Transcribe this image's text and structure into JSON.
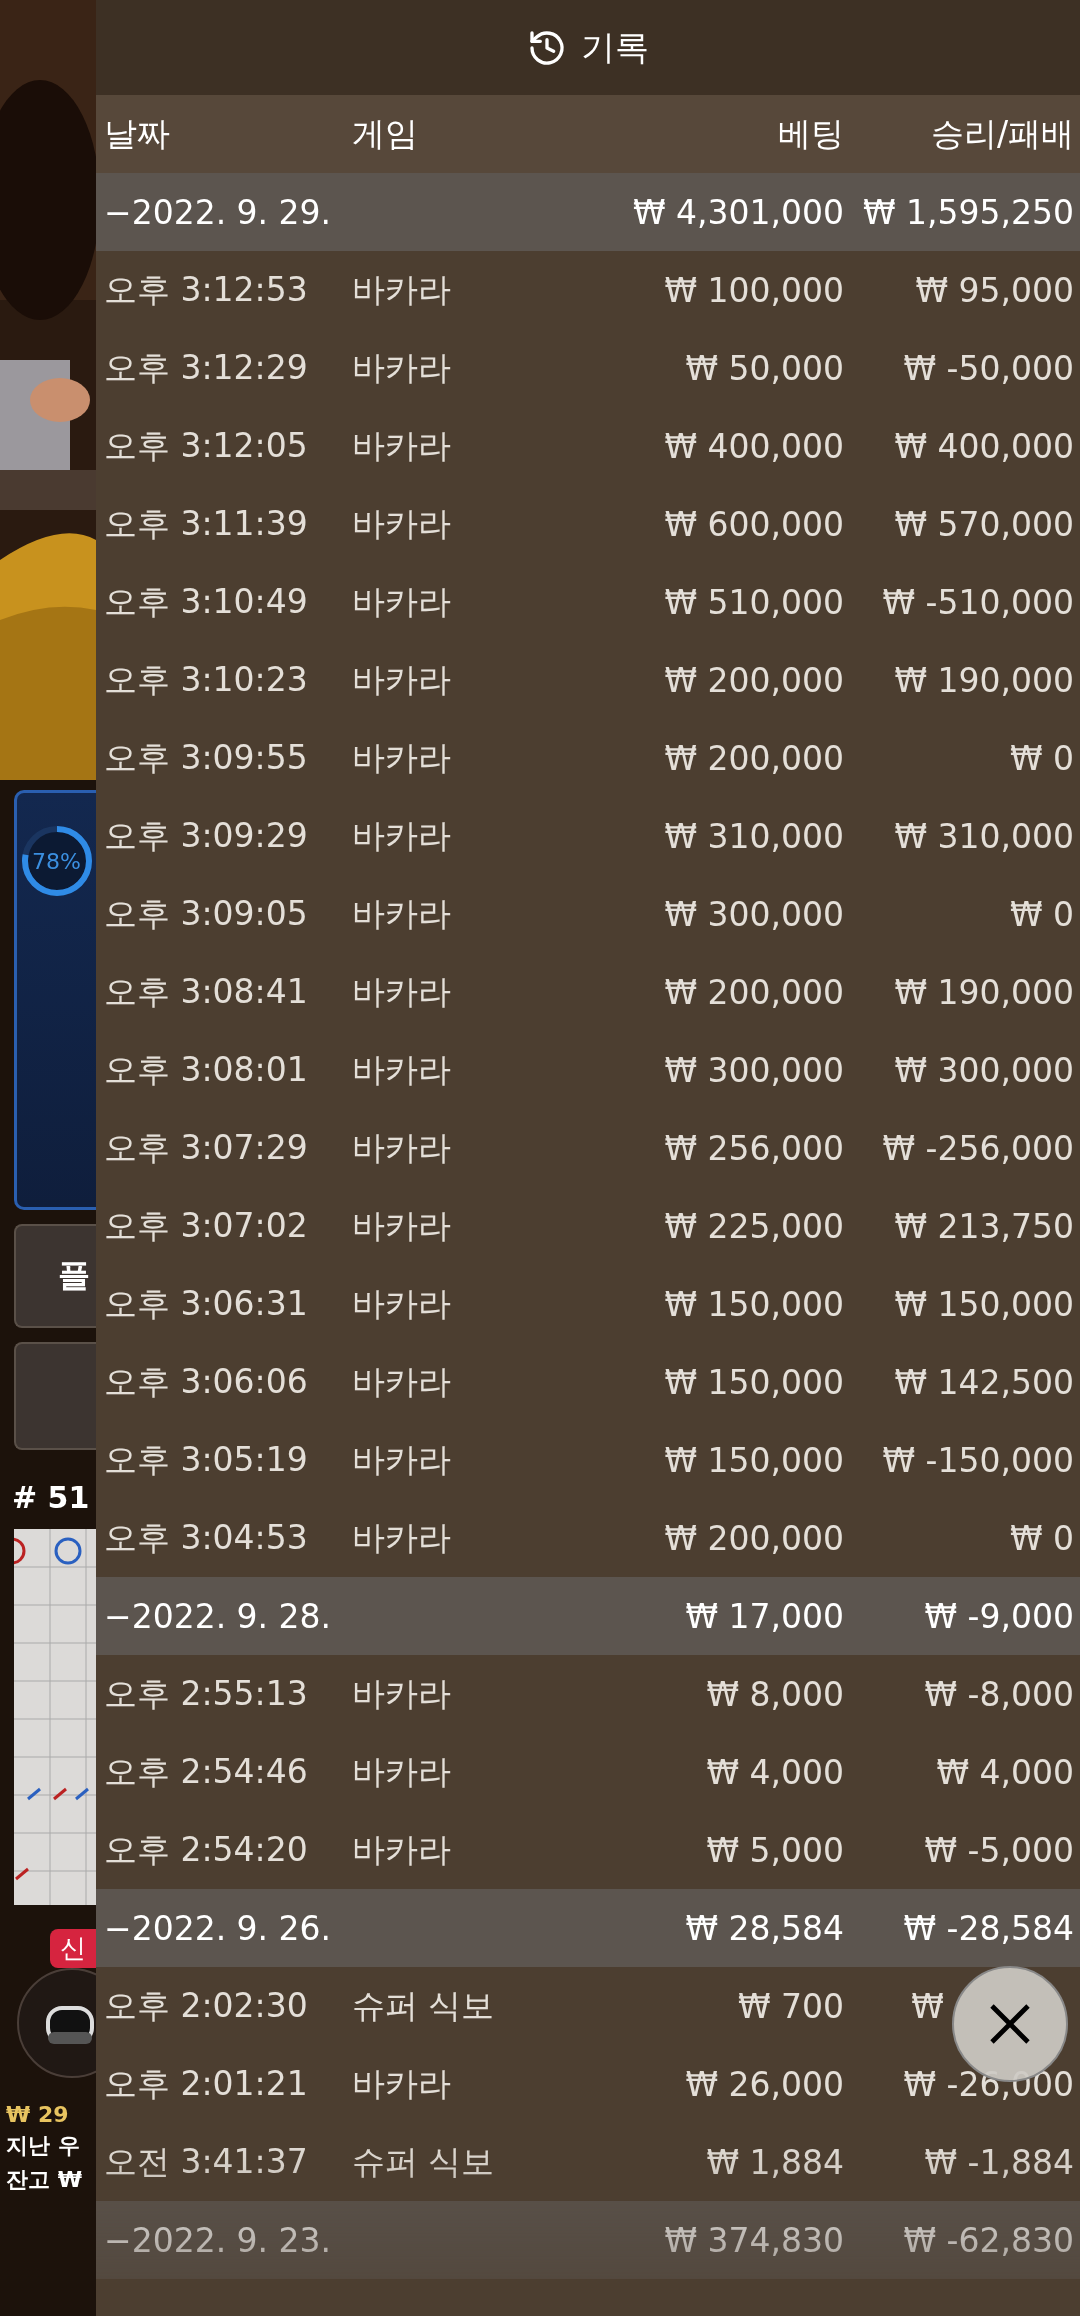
{
  "side": {
    "progress": {
      "label": "78%",
      "level": 0.78
    },
    "buttons": [
      "플"
    ],
    "round": "# 51",
    "badge": "신",
    "amount": "₩ 29",
    "last_win": "지난 우",
    "balance": "잔고 ₩"
  },
  "header": {
    "title": "기록"
  },
  "columns": [
    "날짜",
    "게임",
    "베팅",
    "승리/패배"
  ],
  "groups": [
    {
      "date": "−2022. 9. 29.",
      "bet": "₩ 4,301,000",
      "result": "₩ 1,595,250",
      "rows": [
        {
          "time": "오후 3:12:53",
          "game": "바카라",
          "bet": "₩ 100,000",
          "result": "₩ 95,000"
        },
        {
          "time": "오후 3:12:29",
          "game": "바카라",
          "bet": "₩ 50,000",
          "result": "₩ -50,000"
        },
        {
          "time": "오후 3:12:05",
          "game": "바카라",
          "bet": "₩ 400,000",
          "result": "₩ 400,000"
        },
        {
          "time": "오후 3:11:39",
          "game": "바카라",
          "bet": "₩ 600,000",
          "result": "₩ 570,000"
        },
        {
          "time": "오후 3:10:49",
          "game": "바카라",
          "bet": "₩ 510,000",
          "result": "₩ -510,000"
        },
        {
          "time": "오후 3:10:23",
          "game": "바카라",
          "bet": "₩ 200,000",
          "result": "₩ 190,000"
        },
        {
          "time": "오후 3:09:55",
          "game": "바카라",
          "bet": "₩ 200,000",
          "result": "₩ 0"
        },
        {
          "time": "오후 3:09:29",
          "game": "바카라",
          "bet": "₩ 310,000",
          "result": "₩ 310,000"
        },
        {
          "time": "오후 3:09:05",
          "game": "바카라",
          "bet": "₩ 300,000",
          "result": "₩ 0"
        },
        {
          "time": "오후 3:08:41",
          "game": "바카라",
          "bet": "₩ 200,000",
          "result": "₩ 190,000"
        },
        {
          "time": "오후 3:08:01",
          "game": "바카라",
          "bet": "₩ 300,000",
          "result": "₩ 300,000"
        },
        {
          "time": "오후 3:07:29",
          "game": "바카라",
          "bet": "₩ 256,000",
          "result": "₩ -256,000"
        },
        {
          "time": "오후 3:07:02",
          "game": "바카라",
          "bet": "₩ 225,000",
          "result": "₩ 213,750"
        },
        {
          "time": "오후 3:06:31",
          "game": "바카라",
          "bet": "₩ 150,000",
          "result": "₩ 150,000"
        },
        {
          "time": "오후 3:06:06",
          "game": "바카라",
          "bet": "₩ 150,000",
          "result": "₩ 142,500"
        },
        {
          "time": "오후 3:05:19",
          "game": "바카라",
          "bet": "₩ 150,000",
          "result": "₩ -150,000"
        },
        {
          "time": "오후 3:04:53",
          "game": "바카라",
          "bet": "₩ 200,000",
          "result": "₩ 0"
        }
      ]
    },
    {
      "date": "−2022. 9. 28.",
      "bet": "₩ 17,000",
      "result": "₩ -9,000",
      "rows": [
        {
          "time": "오후 2:55:13",
          "game": "바카라",
          "bet": "₩ 8,000",
          "result": "₩ -8,000"
        },
        {
          "time": "오후 2:54:46",
          "game": "바카라",
          "bet": "₩ 4,000",
          "result": "₩ 4,000"
        },
        {
          "time": "오후 2:54:20",
          "game": "바카라",
          "bet": "₩ 5,000",
          "result": "₩ -5,000"
        }
      ]
    },
    {
      "date": "−2022. 9. 26.",
      "bet": "₩ 28,584",
      "result": "₩ -28,584",
      "rows": [
        {
          "time": "오후 2:02:30",
          "game": "슈퍼 식보",
          "bet": "₩ 700",
          "result": "₩",
          "covered": true
        },
        {
          "time": "오후 2:01:21",
          "game": "바카라",
          "bet": "₩ 26,000",
          "result": "₩ -26,000"
        },
        {
          "time": "오전 3:41:37",
          "game": "슈퍼 식보",
          "bet": "₩ 1,884",
          "result": "₩ -1,884"
        }
      ]
    },
    {
      "date": "−2022. 9. 23.",
      "bet": "₩ 374,830",
      "result": "₩ -62,830"
    }
  ]
}
